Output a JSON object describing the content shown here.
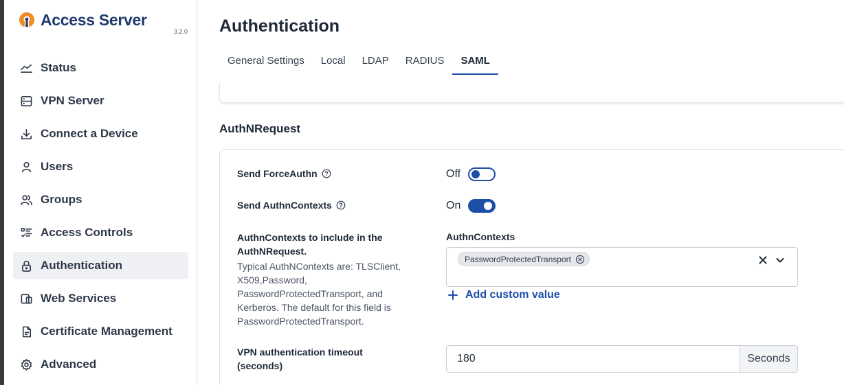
{
  "brand": {
    "name": "Access Server",
    "version": "3.2.0",
    "accent": "#f08a24"
  },
  "sidebar": {
    "items": [
      {
        "label": "Status",
        "icon": "chart-line-icon",
        "active": false
      },
      {
        "label": "VPN Server",
        "icon": "server-icon",
        "active": false
      },
      {
        "label": "Connect a Device",
        "icon": "download-icon",
        "active": false
      },
      {
        "label": "Users",
        "icon": "user-icon",
        "active": false
      },
      {
        "label": "Groups",
        "icon": "users-icon",
        "active": false
      },
      {
        "label": "Access Controls",
        "icon": "list-checks-icon",
        "active": false
      },
      {
        "label": "Authentication",
        "icon": "lock-icon",
        "active": true
      },
      {
        "label": "Web Services",
        "icon": "devices-icon",
        "active": false
      },
      {
        "label": "Certificate Management",
        "icon": "file-certificate-icon",
        "active": false
      },
      {
        "label": "Advanced",
        "icon": "gear-icon",
        "active": false
      }
    ]
  },
  "page": {
    "title": "Authentication",
    "tabs": [
      {
        "label": "General Settings",
        "active": false
      },
      {
        "label": "Local",
        "active": false
      },
      {
        "label": "LDAP",
        "active": false
      },
      {
        "label": "RADIUS",
        "active": false
      },
      {
        "label": "SAML",
        "active": true
      }
    ]
  },
  "authn_request": {
    "section_title": "AuthNRequest",
    "send_force_authn": {
      "label": "Send ForceAuthn",
      "state_text": "Off",
      "enabled": false
    },
    "send_authn_contexts": {
      "label": "Send AuthnContexts",
      "state_text": "On",
      "enabled": true
    },
    "contexts": {
      "title": "AuthnContexts to include in the AuthNRequest.",
      "description": "Typical AuthNContexts are: TLSClient, X509,Password, PasswordProtectedTransport, and Kerberos. The default for this field is PasswordProtectedTransport.",
      "field_label": "AuthnContexts",
      "selected": [
        "PasswordProtectedTransport"
      ],
      "add_custom_label": "Add custom value"
    },
    "timeout": {
      "label": "VPN authentication timeout (seconds)",
      "value": "180",
      "suffix": "Seconds"
    }
  },
  "colors": {
    "primary": "#1e4fa8",
    "brand_text": "#1e3a6e",
    "active_nav_bg": "#eef0f3"
  }
}
